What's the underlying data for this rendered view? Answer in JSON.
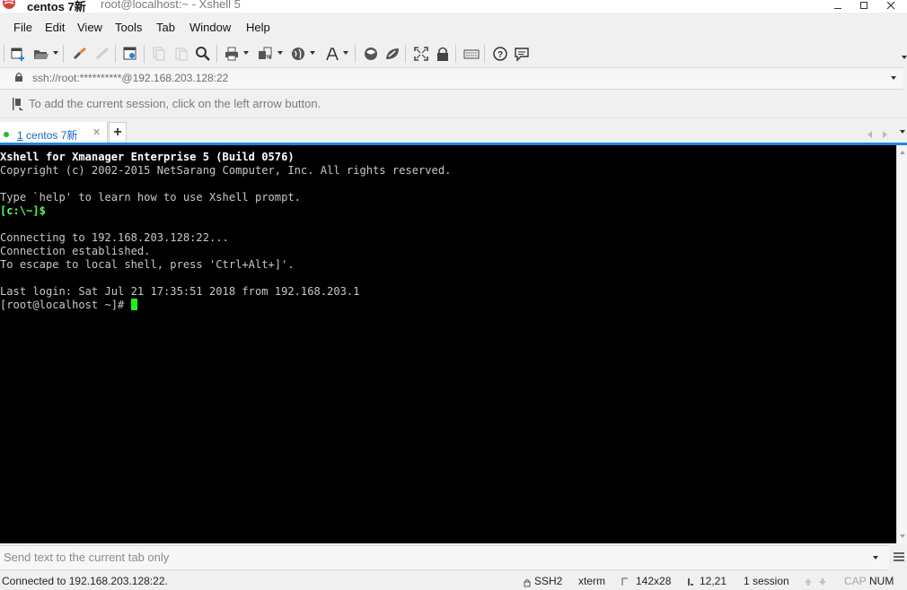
{
  "window": {
    "session_name": "centos 7新",
    "title": "root@localhost:~ - Xshell 5"
  },
  "menu": [
    "File",
    "Edit",
    "View",
    "Tools",
    "Tab",
    "Window",
    "Help"
  ],
  "toolbar": {
    "icons": [
      "new-session-icon",
      "open-session-icon",
      "reconnect-icon",
      "disconnect-icon",
      "properties-icon",
      "copy-icon",
      "paste-icon",
      "find-icon",
      "print-icon",
      "transfer-icon",
      "web-icon",
      "font-icon",
      "xftp-icon",
      "xmanager-icon",
      "fullscreen-icon",
      "lock-icon",
      "keyboard-icon",
      "help-icon",
      "chat-icon"
    ]
  },
  "address": {
    "value": "ssh://root:**********@192.168.203.128:22"
  },
  "hint": {
    "text": "To add the current session, click on the left arrow button."
  },
  "tabs": [
    {
      "number": "1",
      "label": "centos 7新",
      "active": true
    }
  ],
  "terminal": {
    "lines": [
      "Xshell for Xmanager Enterprise 5 (Build 0576)",
      "Copyright (c) 2002-2015 NetSarang Computer, Inc. All rights reserved.",
      "",
      "Type `help' to learn how to use Xshell prompt.",
      "[c:\\~]$",
      "",
      "Connecting to 192.168.203.128:22...",
      "Connection established.",
      "To escape to local shell, press 'Ctrl+Alt+]'.",
      "",
      "Last login: Sat Jul 21 17:35:51 2018 from 192.168.203.1",
      "[root@localhost ~]# "
    ]
  },
  "compose": {
    "placeholder": "Send text to the current tab only"
  },
  "status": {
    "connection": "Connected to 192.168.203.128:22.",
    "protocol": "SSH2",
    "terminal_type": "xterm",
    "size": "142x28",
    "cursor_position": "12,21",
    "sessions": "1 session",
    "caps": "CAP",
    "num": "NUM"
  },
  "colors": {
    "accent": "#1b87e5",
    "terminal_bg": "#000000",
    "prompt_green": "#55ff55",
    "cursor": "#22ee22"
  }
}
